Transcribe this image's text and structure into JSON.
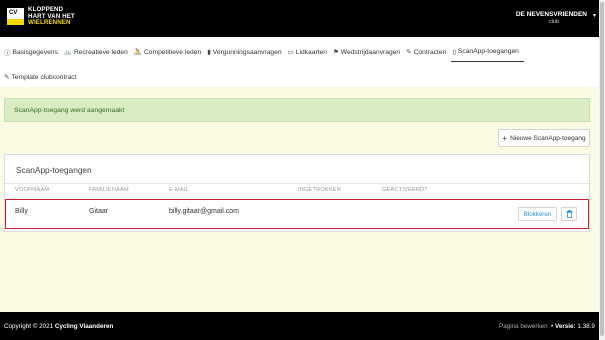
{
  "header": {
    "logo_line1": "KLOPPEND",
    "logo_line2": "HART VAN HET",
    "logo_line3": "WIELRENNEN",
    "logo_mark": "CV",
    "club_name": "DE NEVENSVRIENDEN",
    "club_label": "club"
  },
  "nav": {
    "row1": [
      {
        "icon": "info-icon",
        "glyph": "ⓘ",
        "label": "Basisgegevens"
      },
      {
        "icon": "bicycle-icon",
        "glyph": "🚲",
        "label": "Recreatieve leden"
      },
      {
        "icon": "bicycle-icon",
        "glyph": "🚴",
        "label": "Competitieve leden"
      },
      {
        "icon": "book-icon",
        "glyph": "▮",
        "label": "Vergunningsaanvragen"
      },
      {
        "icon": "id-card-icon",
        "glyph": "▭",
        "label": "Lidkaarten"
      },
      {
        "icon": "flag-icon",
        "glyph": "⚑",
        "label": "Wedstrijdaanvragen"
      },
      {
        "icon": "contract-icon",
        "glyph": "✎",
        "label": "Contracten"
      },
      {
        "icon": "phone-icon",
        "glyph": "▯",
        "label": "ScanApp-toegangen"
      }
    ],
    "row2": [
      {
        "icon": "contract-icon",
        "glyph": "✎",
        "label": "Template clubcontract"
      }
    ],
    "active": "ScanApp-toegangen"
  },
  "alert": {
    "message": "ScanApp-toegang werd aangemaakt",
    "color": "#d9ecc4"
  },
  "actions": {
    "new_label": "Nieuwe ScanApp-toegang"
  },
  "table": {
    "title": "ScanApp-toegangen",
    "headers": [
      "Voornaam",
      "Familienaam",
      "E-mail",
      "Ingetrokken",
      "Geactiveerd?"
    ],
    "rows": [
      {
        "voornaam": "Billy",
        "familienaam": "Gitaar",
        "email": "billy.gitaar@gmail.com",
        "ingetrokken": "",
        "geactiveerd": "",
        "block_label": "Blokkeren"
      }
    ],
    "highlight_color": "#d0202e"
  },
  "footer": {
    "copyright": "Copyright © 2021",
    "org": "Cycling Vlaanderen",
    "edit_label": "Pagina bewerken",
    "version_label": "Versie:",
    "version": "1.38.9"
  },
  "colors": {
    "accent": "#f5d800",
    "link": "#2a8fd6",
    "page_bg": "#fbfbe4"
  }
}
